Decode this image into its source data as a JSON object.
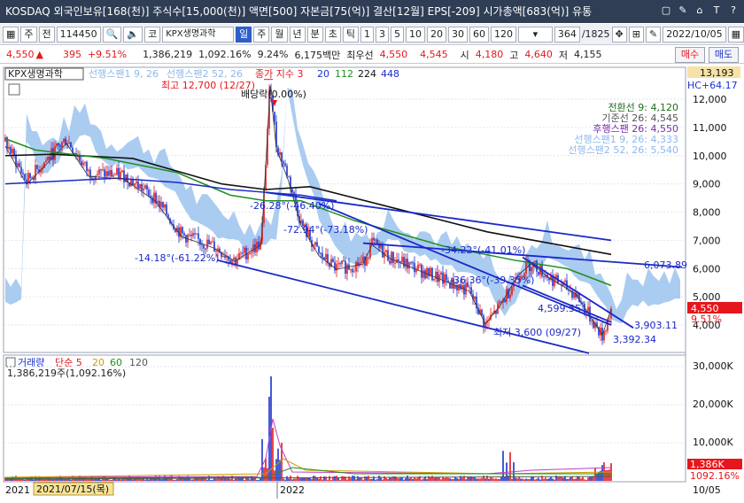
{
  "titlebar": {
    "text": "KOSDAQ 외국인보유[168(천)] 주식수[15,000(천)] 액면[500] 자본금[75(억)] 결산[12월] EPS[-209] 시가총액[683(억)] 유통",
    "icons": [
      "▢",
      "✎",
      "⌂",
      "T",
      "?"
    ]
  },
  "toolbar": {
    "menu_label": "주",
    "all_label": "전",
    "code": "114450",
    "name_label": "코",
    "name": "KPX생명과학",
    "periods": [
      "일",
      "주",
      "월",
      "년",
      "분",
      "초",
      "틱"
    ],
    "selected_period": "일",
    "intervals": [
      "1",
      "3",
      "5",
      "10",
      "20",
      "30",
      "60",
      "120"
    ],
    "count": "364",
    "total": "/1825",
    "date": "2022/10/05"
  },
  "quote": {
    "price": "4,550",
    "up_arrow": "▲",
    "change": "395",
    "change_pct": "+9.51%",
    "volume": "1,386,219",
    "volume_pct": "1,092.16%",
    "turnover": "9.24%",
    "amount": "6,175백만",
    "best_ask_label": "최우선",
    "best_ask": "4,550",
    "best_bid": "4,545",
    "open_label": "시",
    "open": "4,180",
    "high_label": "고",
    "high": "4,640",
    "low_label": "저",
    "low": "4,155",
    "buy_label": "매수",
    "sell_label": "매도"
  },
  "price_panel": {
    "legend": {
      "name": "KPX생명과학",
      "span1": "선행스팬1 9, 26",
      "span2": "선행스팬2 52, 26",
      "close": "종가 지수 3",
      "ma20": "20",
      "ma112": "112",
      "ma224": "224",
      "ma448": "448"
    },
    "ichimoku_legend": [
      {
        "text": "전환선 9: 4,120",
        "color": "#1e6d1e"
      },
      {
        "text": "기준선 26: 4,545",
        "color": "#555555"
      },
      {
        "text": "후행스팬 26: 4,550",
        "color": "#7a2aa8"
      },
      {
        "text": "선행스팬1 9, 26: 4,333",
        "color": "#8eb8ea"
      },
      {
        "text": "선행스팬2 52, 26: 5,540",
        "color": "#8eb8ea"
      }
    ],
    "annotations": {
      "high": "최고 12,700 (12/27)",
      "dividend": "배당락(0.00%)",
      "low": "최저 3,600 (09/27)",
      "t1": "-14.18°(-61.22%)",
      "t2": "-26.28°(-46.40%)",
      "t3": "-72.94°(-73.18%)",
      "t4": "-34.22°(-41.01%)",
      "t5": "-36.36°(-39.35%)",
      "t6": "4,599.55",
      "r1": "6,073.89",
      "r2": "3,903.11",
      "r3": "3,392.34"
    },
    "axis": {
      "top_value": "13,193",
      "hc_label": "HC+64.17",
      "ticks": [
        "12,000",
        "11,000",
        "10,000",
        "9,000",
        "8,000",
        "7,000",
        "6,000",
        "5,000",
        "4,000"
      ],
      "current_price": "4,550",
      "current_pct": "9.51%"
    }
  },
  "volume_panel": {
    "legend": {
      "name": "거래량",
      "ma": "단순 5",
      "ma20": "20",
      "ma60": "60",
      "ma120": "120",
      "value": "1,386,219주(1,092.16%)"
    },
    "axis": {
      "ticks": [
        "30,000K",
        "20,000K",
        "10,000K"
      ],
      "current": "1,386K",
      "current_pct": "1092.16%"
    }
  },
  "xaxis": {
    "labels": [
      "2021",
      "2022"
    ],
    "cursor_date": "2021/07/15(목)",
    "right_label": "10/05"
  },
  "colors": {
    "up": "#e5161c",
    "down": "#1a33cc",
    "cloud": "#9cc3ee",
    "ma_green": "#1e8f1e",
    "ma_black": "#111111",
    "trend_blue": "#1a28c8"
  }
}
